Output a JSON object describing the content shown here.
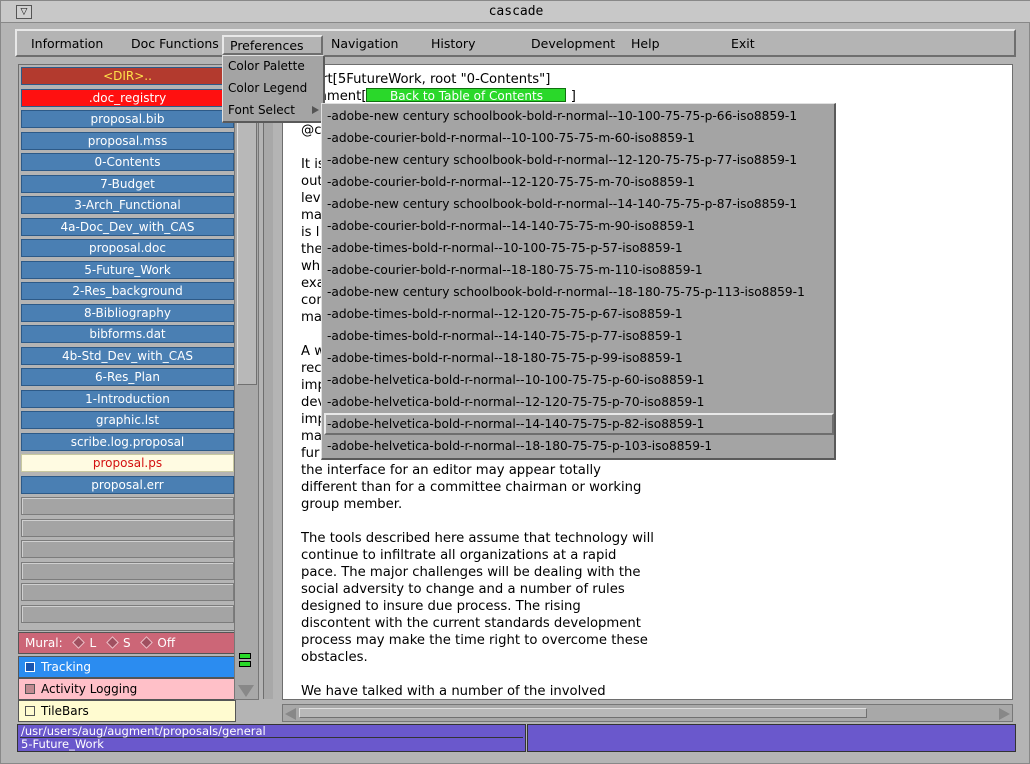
{
  "window": {
    "title": "cascade",
    "menu_button_glyph": "▽"
  },
  "menubar": {
    "items": [
      "Information",
      "Doc Functions",
      "Preferences",
      "Navigation",
      "History",
      "Development",
      "Help",
      "Exit"
    ]
  },
  "preferences_menu": {
    "items": [
      "Color Palette",
      "Color Legend",
      "Font Select"
    ]
  },
  "font_menu": {
    "items": [
      "-adobe-new century schoolbook-bold-r-normal--10-100-75-75-p-66-iso8859-1",
      "-adobe-courier-bold-r-normal--10-100-75-75-m-60-iso8859-1",
      "-adobe-new century schoolbook-bold-r-normal--12-120-75-75-p-77-iso8859-1",
      "-adobe-courier-bold-r-normal--12-120-75-75-m-70-iso8859-1",
      "-adobe-new century schoolbook-bold-r-normal--14-140-75-75-p-87-iso8859-1",
      "-adobe-courier-bold-r-normal--14-140-75-75-m-90-iso8859-1",
      "-adobe-times-bold-r-normal--10-100-75-75-p-57-iso8859-1",
      "-adobe-courier-bold-r-normal--18-180-75-75-m-110-iso8859-1",
      "-adobe-new century schoolbook-bold-r-normal--18-180-75-75-p-113-iso8859-1",
      "-adobe-times-bold-r-normal--12-120-75-75-p-67-iso8859-1",
      "-adobe-times-bold-r-normal--14-140-75-75-p-77-iso8859-1",
      "-adobe-times-bold-r-normal--18-180-75-75-p-99-iso8859-1",
      "-adobe-helvetica-bold-r-normal--10-100-75-75-p-60-iso8859-1",
      "-adobe-helvetica-bold-r-normal--12-120-75-75-p-70-iso8859-1",
      "-adobe-helvetica-bold-r-normal--14-140-75-75-p-82-iso8859-1",
      "-adobe-helvetica-bold-r-normal--18-180-75-75-p-103-iso8859-1"
    ],
    "highlighted_index": 14
  },
  "file_list": {
    "items": [
      "<DIR>..",
      ".doc_registry",
      "proposal.bib",
      "proposal.mss",
      "0-Contents",
      "7-Budget",
      "3-Arch_Functional",
      "4a-Doc_Dev_with_CAS",
      "proposal.doc",
      "5-Future_Work",
      "2-Res_background",
      "8-Bibliography",
      "bibforms.dat",
      "4b-Std_Dev_with_CAS",
      "6-Res_Plan",
      "1-Introduction",
      "graphic.lst",
      "scribe.log.proposal",
      "proposal.ps",
      "proposal.err"
    ],
    "selected_index": 18
  },
  "mural": {
    "label": "Mural:",
    "options": [
      "L",
      "S",
      "Off"
    ]
  },
  "toggles": {
    "tracking": "Tracking",
    "logging": "Activity Logging",
    "tilebars": "TileBars"
  },
  "document": {
    "line1": "art[5FutureWork, root \"0-Contents\"]",
    "line2_prefix": "mment[",
    "line2_suffix": "]",
    "back_button": "Back to Table of Contents",
    "line3": "@c",
    "para1_frags": [
      "It is",
      "out",
      "lev",
      "ma",
      "is l",
      "the",
      "wh",
      "exa",
      "con",
      "ma"
    ],
    "para2_frags": [
      "A w",
      "rec",
      "imp",
      "dev",
      "imp",
      "ma",
      "fur"
    ],
    "para2_tail": [
      "the interface for an editor may appear totally",
      "different than for a committee chairman or working",
      "group member."
    ],
    "para3": [
      "The tools described here assume that technology will",
      "continue to infiltrate all organizations at a rapid",
      "pace.  The major challenges will be dealing with the",
      "social adversity to change and a number of rules",
      "designed to insure due process.  The rising",
      "discontent with the current standards development",
      "process may make the time right to overcome these",
      "obstacles."
    ],
    "para4": "We have talked with a number of the involved"
  },
  "status": {
    "path": "/usr/users/aug/augment/proposals/general",
    "node": "5-Future_Work"
  }
}
